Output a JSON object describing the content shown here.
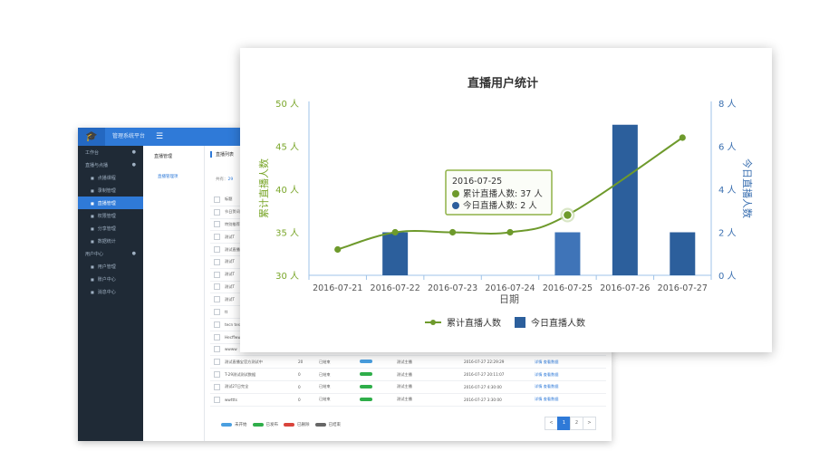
{
  "backend": {
    "app_title": "管理系统平台",
    "sidebar": [
      {
        "label": "工作台",
        "level": 0,
        "dot": "●"
      },
      {
        "label": "直播与点播",
        "level": 0,
        "dot": "●"
      },
      {
        "label": "点播课程",
        "level": 1
      },
      {
        "label": "录制管理",
        "level": 1
      },
      {
        "label": "直播管理",
        "level": 1,
        "active": true
      },
      {
        "label": "权限管理",
        "level": 1
      },
      {
        "label": "分享管理",
        "level": 1
      },
      {
        "label": "数据统计",
        "level": 1
      },
      {
        "label": "用户中心",
        "level": 0,
        "dot": "●"
      },
      {
        "label": "用户管理",
        "level": 1
      },
      {
        "label": "账户中心",
        "level": 1
      },
      {
        "label": "消息中心",
        "level": 1
      }
    ],
    "subnav_header": "直播管理",
    "subnav_item": "直播管理项",
    "tab_label": "直播列表",
    "filter_label": "共有：",
    "filter_value": "29",
    "rows": [
      {
        "name": "标题",
        "num": "",
        "type": "",
        "status": "",
        "host": "",
        "time": "",
        "ops": ""
      },
      {
        "name": "节日贺词",
        "num": "",
        "type": "",
        "status": "",
        "host": "",
        "time": "",
        "ops": ""
      },
      {
        "name": "特别推荐",
        "num": "",
        "type": "",
        "status": "",
        "host": "",
        "time": "",
        "ops": ""
      },
      {
        "name": "测试T",
        "num": "",
        "type": "",
        "status": "",
        "host": "",
        "time": "",
        "ops": ""
      },
      {
        "name": "测试直播",
        "num": "",
        "type": "",
        "status": "",
        "host": "",
        "time": "",
        "ops": ""
      },
      {
        "name": "测试T",
        "num": "",
        "type": "",
        "status": "",
        "host": "",
        "time": "",
        "ops": ""
      },
      {
        "name": "测试T",
        "num": "",
        "type": "",
        "status": "",
        "host": "",
        "time": "",
        "ops": ""
      },
      {
        "name": "测试T",
        "num": "",
        "type": "",
        "status": "",
        "host": "",
        "time": "",
        "ops": ""
      },
      {
        "name": "测试T",
        "num": "",
        "type": "",
        "status": "",
        "host": "",
        "time": "",
        "ops": ""
      },
      {
        "name": "tt",
        "num": "",
        "type": "",
        "status": "",
        "host": "",
        "time": "",
        "ops": ""
      },
      {
        "name": "tecn test",
        "num": "",
        "type": "",
        "status": "",
        "host": "",
        "time": "",
        "ops": ""
      },
      {
        "name": "Hecffwwer",
        "num": "",
        "type": "",
        "status": "",
        "host": "",
        "time": "",
        "ops": ""
      },
      {
        "name": "wwww",
        "num": "",
        "type": "",
        "status": "",
        "host": "",
        "time": "",
        "ops": ""
      },
      {
        "name": "测试直播宝官方测试中",
        "num": "20",
        "type": "已结束",
        "status": "blue",
        "host": "测试主播",
        "time": "2016-07-27 22:29:29",
        "ops": "详情  查看数据"
      },
      {
        "name": "T-29测试测试数据",
        "num": "0",
        "type": "已结束",
        "status": "green",
        "host": "测试主播",
        "time": "2016-07-27 20:11:07",
        "ops": "详情  查看数据"
      },
      {
        "name": "测试27日完全",
        "num": "0",
        "type": "已结束",
        "status": "green",
        "host": "测试主播",
        "time": "2016-07-27 4:30:00",
        "ops": "详情  查看数据"
      },
      {
        "name": "wwttts",
        "num": "0",
        "type": "已结束",
        "status": "green",
        "host": "测试主播",
        "time": "2016-07-27 3:30:00",
        "ops": "详情  查看数据"
      }
    ],
    "legend": [
      {
        "label": "未开始",
        "color": "#4a9fe0"
      },
      {
        "label": "已发布",
        "color": "#2fae4a"
      },
      {
        "label": "已删除",
        "color": "#d9443b"
      },
      {
        "label": "已结束",
        "color": "#666666"
      }
    ],
    "pager": [
      "<",
      "1",
      "2",
      ">"
    ],
    "pager_active": "1",
    "colors": {
      "blue": "#4a9fe0",
      "green": "#2fae4a",
      "red": "#d9443b",
      "gray": "#666666"
    }
  },
  "chart_data": {
    "type": "bar",
    "title": "直播用户统计",
    "xlabel": "日期",
    "categories": [
      "2016-07-21",
      "2016-07-22",
      "2016-07-23",
      "2016-07-24",
      "2016-07-25",
      "2016-07-26",
      "2016-07-27"
    ],
    "left_axis": {
      "label": "累计直播人数",
      "ylim": [
        30,
        50
      ],
      "ticks": [
        "30 人",
        "35 人",
        "40 人",
        "45 人",
        "50 人"
      ],
      "color": "#7aa62a"
    },
    "right_axis": {
      "label": "今日直播人数",
      "ylim": [
        0,
        8
      ],
      "ticks": [
        "0 人",
        "2 人",
        "4 人",
        "6 人",
        "8 人"
      ],
      "color": "#3a6fb0"
    },
    "series": [
      {
        "name": "累计直播人数",
        "type": "line",
        "axis": "left",
        "color": "#6e9a2c",
        "values": [
          33,
          35,
          35,
          35,
          37,
          null,
          46
        ]
      },
      {
        "name": "今日直播人数",
        "type": "bar",
        "axis": "right",
        "color": "#2c5f9c",
        "values": [
          null,
          2,
          null,
          null,
          2,
          7,
          2
        ]
      }
    ],
    "tooltip": {
      "date": "2016-07-25",
      "line1": "累计直播人数: 37 人",
      "line2": "今日直播人数: 2 人"
    },
    "legend": [
      "累计直播人数",
      "今日直播人数"
    ],
    "legend_position": "bottom",
    "grid": false
  }
}
